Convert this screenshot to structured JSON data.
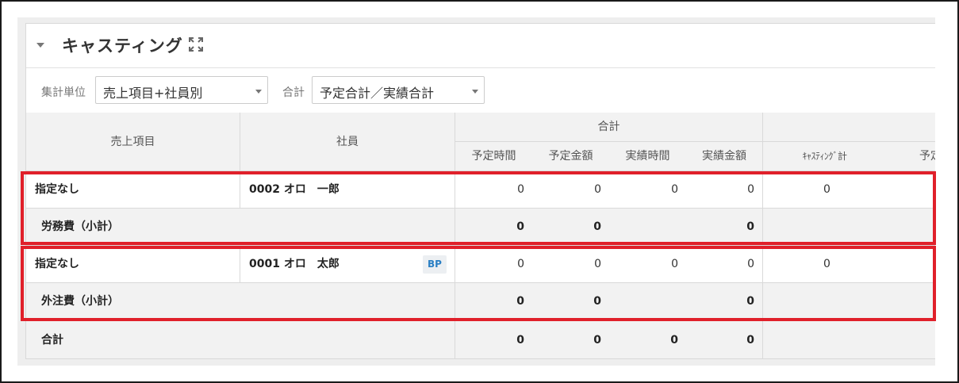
{
  "panel": {
    "title": "キャスティング"
  },
  "filters": {
    "unit_label": "集計単位",
    "unit_value": "売上項目+社員別",
    "total_label": "合計",
    "total_value": "予定合計／実績合計"
  },
  "table": {
    "headers": {
      "sales_item": "売上項目",
      "employee": "社員",
      "group_total": "合計",
      "plan_hours": "予定時間",
      "plan_amount": "予定金額",
      "actual_hours": "実績時間",
      "actual_amount": "実績金額",
      "casting_total": "ｷｬｽﾃｨﾝｸﾞ計",
      "next_partial": "予定"
    },
    "rows": [
      {
        "sales_item": "指定なし",
        "employee": "0002 オロ　一郎",
        "badge": "",
        "plan_hours": "0",
        "plan_amount": "0",
        "actual_hours": "0",
        "actual_amount": "0",
        "casting": "0"
      },
      {
        "subtotal_label": "労務費（小計）",
        "plan_hours": "0",
        "plan_amount": "0",
        "actual_hours": "",
        "actual_amount": "0"
      },
      {
        "sales_item": "指定なし",
        "employee": "0001 オロ　太郎",
        "badge": "BP",
        "plan_hours": "0",
        "plan_amount": "0",
        "actual_hours": "0",
        "actual_amount": "0",
        "casting": "0"
      },
      {
        "subtotal_label": "外注費（小計）",
        "plan_hours": "0",
        "plan_amount": "0",
        "actual_hours": "",
        "actual_amount": "0"
      }
    ],
    "total": {
      "label": "合計",
      "plan_hours": "0",
      "plan_amount": "0",
      "actual_hours": "0",
      "actual_amount": "0"
    }
  },
  "icons": {
    "collapse": "caret-down-icon",
    "expand": "fullscreen-icon",
    "select_caret": "chevron-down-icon"
  },
  "colors": {
    "highlight": "#e0202a",
    "badge_text": "#2a7fc4",
    "header_bg": "#f2f2f2"
  }
}
